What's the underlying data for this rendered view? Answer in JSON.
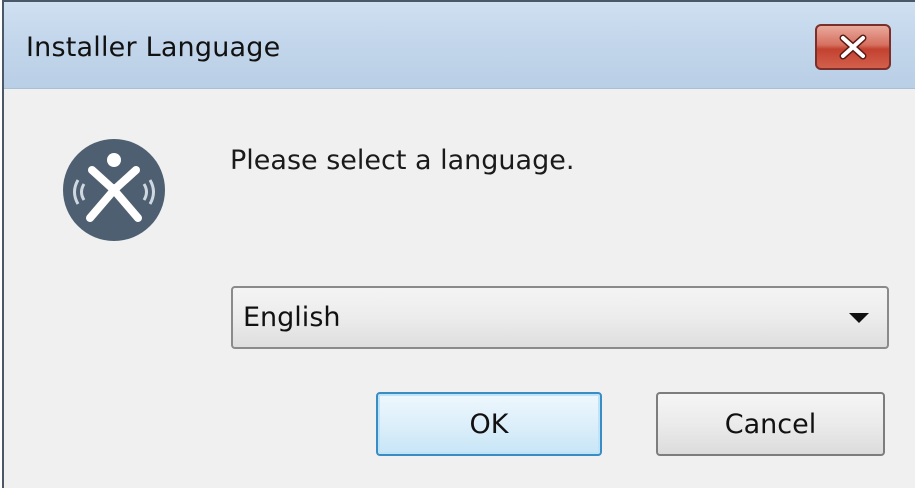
{
  "window": {
    "title": "Installer Language",
    "close_icon": "close-icon"
  },
  "dialog": {
    "app_icon": "installer-app-icon",
    "prompt": "Please select a language.",
    "language_select": {
      "selected": "English",
      "arrow_icon": "dropdown-arrow-icon"
    },
    "buttons": {
      "ok_label": "OK",
      "cancel_label": "Cancel"
    }
  },
  "colors": {
    "titlebar": "#c3d6eb",
    "close_button": "#c3412f",
    "app_icon_bg": "#4d5f70",
    "ok_border": "#3a8cc4",
    "client_bg": "#f0f0f0"
  }
}
